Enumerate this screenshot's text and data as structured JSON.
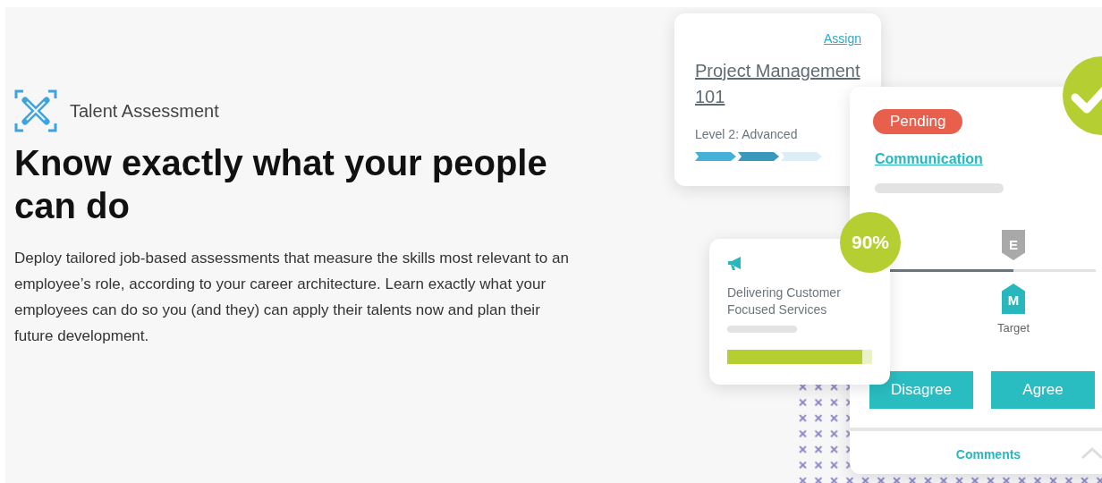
{
  "header": {
    "title": "Talent Assessment"
  },
  "headline": "Know exactly what your people can do",
  "description": "Deploy tailored job-based assessments that measure the skills most relevant to an employee’s role, according to your career architecture. Learn exactly what your employees can do so you (and they) can apply their talents now and plan their future development.",
  "course_card": {
    "action": "Assign",
    "title": "Project Management 101",
    "level_label": "Level 2: Advanced",
    "steps": [
      {
        "done": true
      },
      {
        "done": true
      },
      {
        "done": false
      }
    ]
  },
  "skill_card": {
    "approved": true,
    "status": "Pending",
    "skill": "Communication",
    "current_marker": "E",
    "target_marker": "M",
    "target_label": "Target",
    "level": 0.6,
    "buttons": [
      "Disagree",
      "Agree"
    ],
    "footer": "Comments"
  },
  "service_card": {
    "score": "90%",
    "title": "Delivering Customer Focused Services",
    "level": 0.93
  }
}
